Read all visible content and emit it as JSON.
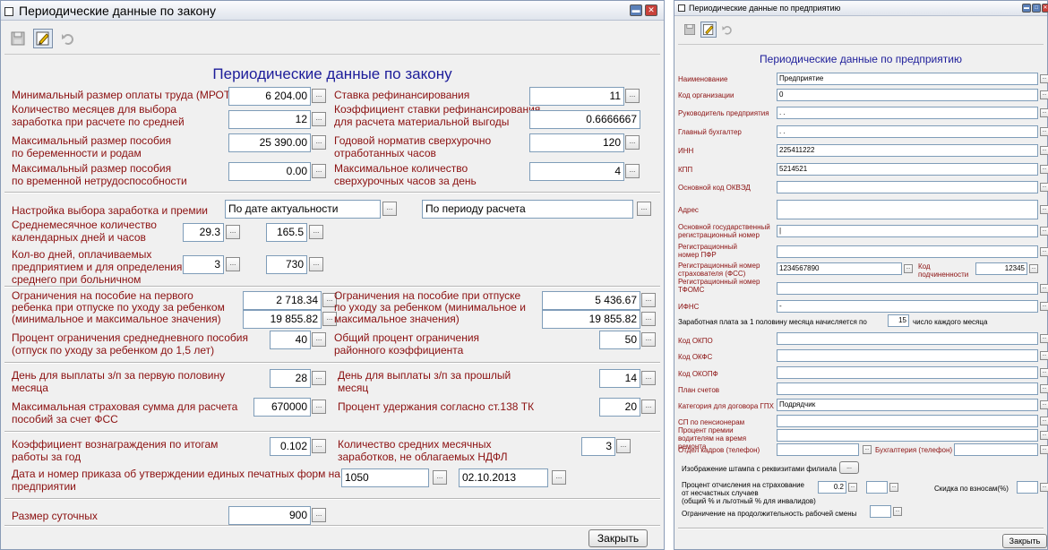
{
  "w1": {
    "title": "Периодические данные по закону",
    "heading": "Периодические данные по закону",
    "ellipsis": "...",
    "mrot_label": "Минимальный размер оплаты труда (МРОТ)",
    "mrot_value": "6 204.00",
    "months_label_1": "Количество месяцев для выбора",
    "months_label_2": "заработка при расчете по средней",
    "months_value": "12",
    "maternity_label_1": "Максимальный размер пособия",
    "maternity_label_2": "по беременности и родам",
    "maternity_value": "25 390.00",
    "disability_label_1": "Максимальный размер пособия",
    "disability_label_2": "по временной нетрудоспособности",
    "disability_value": "0.00",
    "refin_label": "Ставка рефинансирования",
    "refin_value": "11",
    "refin_coef_label_1": "Коэффициент ставки рефинансирования",
    "refin_coef_label_2": "для расчета материальной выгоды",
    "refin_coef_value": "0.6666667",
    "overtime_norm_label_1": "Годовой норматив сверхурочно",
    "overtime_norm_label_2": "отработанных часов",
    "overtime_norm_value": "120",
    "overtime_day_label_1": "Максимальное количество",
    "overtime_day_label_2": "сверхурочных часов за день",
    "overtime_day_value": "4",
    "earnings_setting_label": "Настройка выбора заработка и премии",
    "earnings_select_1": "По дате актуальности",
    "earnings_select_2": "По периоду расчета",
    "avg_count_label_1": "Среднемесячное количество",
    "avg_count_label_2": "календарных дней и часов",
    "avg_days_value": "29.3",
    "avg_hours_value": "165.5",
    "paid_days_label_1": "Кол-во дней, оплачиваемых",
    "paid_days_label_2": "предприятием и для определения",
    "paid_days_label_3": "среднего при больничном",
    "paid_days_value": "3",
    "paid_days_value_2": "730",
    "child1_label_1": "Ограничения на пособие на первого",
    "child1_label_2": "ребенка при отпуске по уходу за ребенком",
    "child1_label_3": "(минимальное и максимальное значения)",
    "child1_min": "2 718.34",
    "child1_max": "19 855.82",
    "child_label_1": "Ограничения на пособие при отпуске",
    "child_label_2": "по уходу за ребенком (минимальное и",
    "child_label_3": "максимальное значения)",
    "child_min": "5 436.67",
    "child_max": "19 855.82",
    "limit_pct_label_1": "Процент ограничения среднедневного пособия",
    "limit_pct_label_2": "(отпуск по уходу за ребенком до 1,5 лет)",
    "limit_pct_value": "40",
    "regional_label_1": "Общий процент ограничения",
    "regional_label_2": "районного коэффициента",
    "regional_value": "50",
    "pay_first_label_1": "День для выплаты з/п за первую половину",
    "pay_first_label_2": "месяца",
    "pay_first_value": "28",
    "pay_prev_label_1": "День для выплаты з/п за прошлый",
    "pay_prev_label_2": "месяц",
    "pay_prev_value": "14",
    "fss_label_1": "Максимальная страховая сумма для расчета",
    "fss_label_2": "пособий за счет ФСС",
    "fss_value": "670000",
    "withhold_label": "Процент удержания согласно ст.138 ТК",
    "withhold_value": "20",
    "bonus_coef_label_1": "Коэффициент вознаграждения по итогам",
    "bonus_coef_label_2": "работы за год",
    "bonus_coef_value": "0.102",
    "ndfl_label_1": "Количество средних месячных",
    "ndfl_label_2": "заработков, не облагаемых НДФЛ",
    "ndfl_value": "3",
    "order_label_1": "Дата и номер приказа об утверждении единых печатных форм на",
    "order_label_2": "предприятии",
    "order_number": "1050",
    "order_date": "02.10.2013",
    "daily_label": "Размер суточных",
    "daily_value": "900",
    "close_label": "Закрыть"
  },
  "w2": {
    "title": "Периодические данные по предприятию",
    "heading": "Периодические данные по предприятию",
    "ellipsis": "...",
    "rows": [
      {
        "label": "Наименование",
        "value": "Предприятие"
      },
      {
        "label": "Код организации",
        "value": "0"
      },
      {
        "label": "Руководитель предприятия",
        "value": " . ."
      },
      {
        "label": "Главный бухгалтер",
        "value": " . ."
      },
      {
        "label": "ИНН",
        "value": "225411222"
      },
      {
        "label": "КПП",
        "value": "5214521"
      },
      {
        "label": "Основной код ОКВЭД",
        "value": ""
      },
      {
        "label": "Адрес",
        "value": ""
      },
      {
        "label": "Основной государственный регистрационный номер",
        "value": "|"
      },
      {
        "label": "Регистрационный номер ПФР",
        "value": ""
      }
    ],
    "fss_reg_label": "Регистрационный номер страхователя (ФСС)",
    "fss_reg_value": "1234567890",
    "sub_code_label": "Код подчиненности",
    "sub_code_value": "12345",
    "tfoms_label": "Регистрационный номер ТФОМС",
    "tfoms_value": "",
    "ifns_label": "ИФНС",
    "ifns_value": "-",
    "salary_label": "Заработная плата за 1 половину месяца начисляется по",
    "salary_day": "15",
    "salary_suffix": "число каждого месяца",
    "rows2": [
      {
        "label": "Код ОКПО",
        "value": ""
      },
      {
        "label": "Код ОКФС",
        "value": ""
      },
      {
        "label": "Код ОКОПФ",
        "value": ""
      },
      {
        "label": "План счетов",
        "value": ""
      },
      {
        "label": "Категория для договора ГПХ",
        "value": "Подрядчик"
      },
      {
        "label": "СП по пенсионерам",
        "value": ""
      },
      {
        "label": "Процент премии водителям на время ремонта",
        "value": ""
      }
    ],
    "hr_label": "Отдел кадров (телефон)",
    "acc_label": "Бухгалтерия (телефон)",
    "stamp_label": "Изображение штампа с реквизитами филиала",
    "accident_label_1": "Процент отчисления на страхование",
    "accident_label_2": "от несчастных случаев",
    "accident_label_3": "(общий % и льготный % для инвалидов)",
    "accident_value": "0.2",
    "discount_label": "Скидка по взносам(%)",
    "shift_label": "Ограничение на продолжительность рабочей смены",
    "close_label": "Закрыть"
  }
}
